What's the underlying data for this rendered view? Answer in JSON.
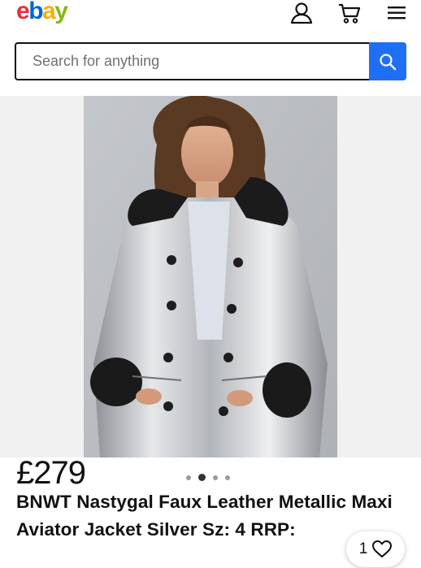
{
  "header": {
    "logo_letters": [
      {
        "char": "e",
        "color": "#e53238"
      },
      {
        "char": "b",
        "color": "#0064d2"
      },
      {
        "char": "a",
        "color": "#f5af02"
      },
      {
        "char": "y",
        "color": "#86b817"
      }
    ],
    "icons": [
      "account-icon",
      "cart-icon",
      "menu-icon"
    ]
  },
  "search": {
    "placeholder": "Search for anything",
    "button_icon": "search-icon",
    "button_color": "#1f6ff5"
  },
  "listing": {
    "price": "£279",
    "title": "BNWT Nastygal Faux Leather Metallic Maxi Aviator Jacket Silver Sz: 4 RRP:",
    "watch_count": "1",
    "gallery_dots": 4,
    "active_dot": 1
  }
}
